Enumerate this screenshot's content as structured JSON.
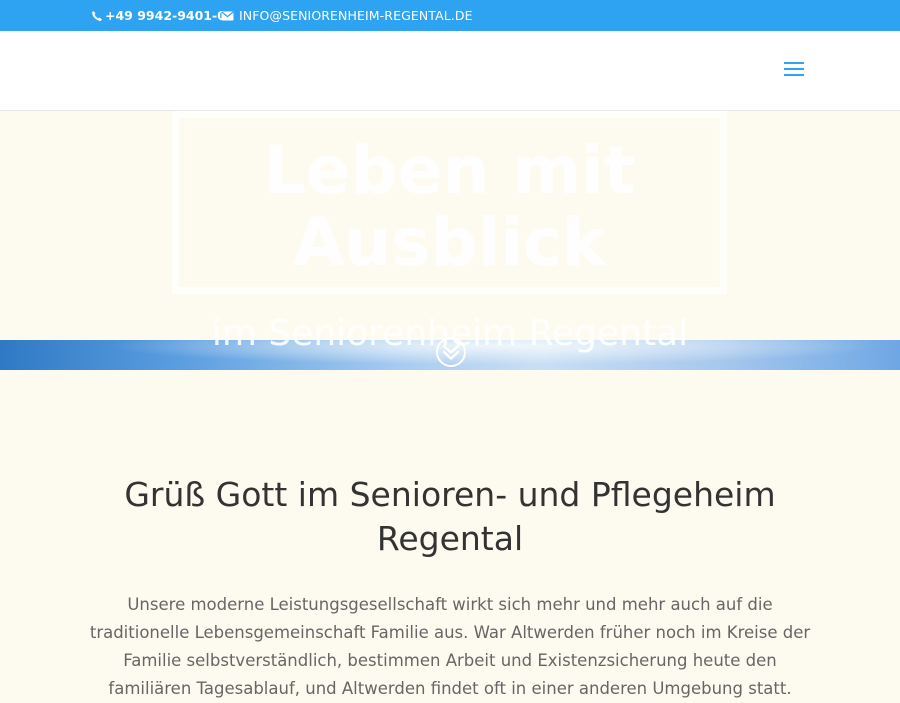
{
  "topbar": {
    "phone": "+49 9942-9401-0",
    "email": "INFO@SENIORENHEIM-REGENTAL.DE",
    "bg_color": "#2ea3f2"
  },
  "header": {
    "menu_icon": "hamburger-menu-icon"
  },
  "hero": {
    "title_line1": "Leben mit",
    "title_line2": "Ausblick",
    "subtitle": "im Seniorenheim Regental",
    "scroll_icon": "chevron-double-down-circle-icon"
  },
  "main": {
    "heading": "Grüß Gott im Senioren- und Pflegeheim Regental",
    "intro": "Unsere moderne Leistungsgesellschaft wirkt sich mehr und mehr auch auf die traditionelle Lebensgemeinschaft Familie aus. War Altwerden früher noch im Kreise der Familie selbstverständlich, bestimmen Arbeit und Existenzsicherung heute den familiären Tagesablauf, und Altwerden findet oft in einer anderen Umgebung statt."
  },
  "colors": {
    "accent": "#2ea3f2",
    "page_bg": "#fdfbef",
    "heading": "#333333",
    "body_text": "#666666"
  }
}
